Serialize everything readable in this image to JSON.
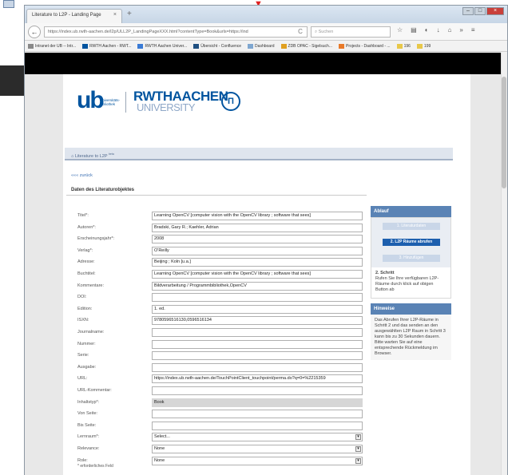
{
  "window": {
    "tab_title": "Literature to L2P - Landing Page",
    "tab_close": "×",
    "new_tab": "+"
  },
  "nav": {
    "back": "←",
    "url": "https://index.ub.rwth-aachen.de/l2p/ULL2P_LandingPageXXX.html?contentType=Book&urls=https://ind",
    "reload": "C",
    "search_placeholder": "Suchen"
  },
  "bookmarks": [
    {
      "label": "Intranet der UB -- Intr...",
      "color": "#888888"
    },
    {
      "label": "RWTH Aachen - RWT...",
      "color": "#00549f"
    },
    {
      "label": "RWTH Aachen Univer...",
      "color": "#3a7bd5"
    },
    {
      "label": "Übersicht - Confluence",
      "color": "#205081"
    },
    {
      "label": "Dashboard",
      "color": "#7fa7d0"
    },
    {
      "label": "ZDB OPAC - Sigelsuch...",
      "color": "#e0a020"
    },
    {
      "label": "Projects - Dashboard - ...",
      "color": "#e87a2a"
    },
    {
      "label": "196",
      "color": "#e8c84a"
    },
    {
      "label": "199",
      "color": "#e8c84a"
    }
  ],
  "logo": {
    "ub": "ub",
    "ub_sub": "Universitäts-bibliothek",
    "rwth": "RWTHAACHEN",
    "university": "UNIVERSITY"
  },
  "breadcrumb": {
    "text": "Literature to L2P",
    "sup": "beta"
  },
  "back_link": "««« zurück",
  "main": {
    "heading": "Daten des Literaturobjektes",
    "fields": [
      {
        "label": "Titel*:",
        "value": "Learning OpenCV [computer vision with the OpenCV library ; software that sees]",
        "type": "input"
      },
      {
        "label": "Autoren*:",
        "value": "Bradski, Gary R.; Kaehler, Adrian",
        "type": "input"
      },
      {
        "label": "Erscheinungsjahr*:",
        "value": "2008",
        "type": "input"
      },
      {
        "label": "Verlag*:",
        "value": "O'Reilly",
        "type": "input"
      },
      {
        "label": "Adresse:",
        "value": "Beijing ; Koln [u.a.]",
        "type": "input"
      },
      {
        "label": "Buchtitel:",
        "value": "Learning OpenCV [computer vision with the OpenCV library ; software that sees]",
        "type": "input"
      },
      {
        "label": "Kommentare:",
        "value": "Bildverarbeitung / Programmbibliothek,OpenCV",
        "type": "input"
      },
      {
        "label": "DOI:",
        "value": "",
        "type": "input"
      },
      {
        "label": "Edition:",
        "value": "1. ed.",
        "type": "input"
      },
      {
        "label": "ISXN:",
        "value": "9780596516130,0596516134",
        "type": "input"
      },
      {
        "label": "Journalname:",
        "value": "",
        "type": "input"
      },
      {
        "label": "Nummer:",
        "value": "",
        "type": "input"
      },
      {
        "label": "Serie:",
        "value": "",
        "type": "input"
      },
      {
        "label": "Ausgabe:",
        "value": "",
        "type": "input"
      },
      {
        "label": "URL:",
        "value": "https://index.ub.rwth-aachen.de/TouchPointClient_touchpoint/perma.do?q=0=%2215359",
        "type": "input"
      },
      {
        "label": "URL-Kommentar:",
        "value": "",
        "type": "input"
      },
      {
        "label": "Inhaltstyp*:",
        "value": "Book",
        "type": "readonly"
      },
      {
        "label": "Von Seite:",
        "value": "",
        "type": "input"
      },
      {
        "label": "Bis Seite:",
        "value": "",
        "type": "input"
      },
      {
        "label": "Lernraum*:",
        "value": "Select...",
        "type": "select"
      },
      {
        "label": "Relevance:",
        "value": "None",
        "type": "select"
      },
      {
        "label": "Role:",
        "value": "None",
        "type": "select"
      }
    ],
    "required_note": "* erforderliches Feld"
  },
  "sidebar": {
    "ablauf_title": "Ablauf",
    "steps": [
      {
        "label": "1. Literaturdaten",
        "active": false
      },
      {
        "label": "2. L2P Räume abrufen",
        "active": true
      },
      {
        "label": "3. Hinzufügen",
        "active": false
      }
    ],
    "step_title": "2. Schritt",
    "step_text": "Rufen Sie Ihre verfügbaren L2P-Räume durch klick auf obigen Button ab",
    "hints_title": "Hinweise",
    "hints_text": "Das Abrufen Ihrer L2P-Räume in Schritt 2 und das senden an den ausgewählten L2P Raum in Schritt 3 kann bis zu 30 Sekunden dauern. Bitte warten Sie auf eine entsprechende Rückmeldung im Browser."
  },
  "colors": {
    "rwth_blue": "#00549f",
    "panel_blue": "#5a83b5",
    "active_step": "#1d5fae"
  }
}
